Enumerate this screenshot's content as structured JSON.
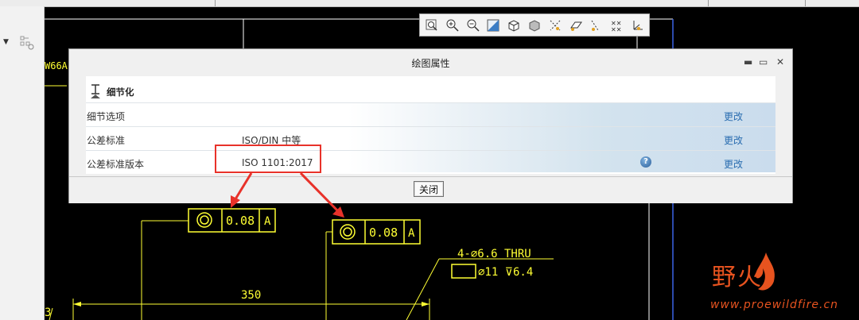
{
  "colors": {
    "accent_link": "#2a6db0",
    "highlight": "#e8322a",
    "drawing_line": "#ffff33",
    "watermark": "#e7531f"
  },
  "toolbar": {
    "icons": [
      "zoom-fit-icon",
      "zoom-in-icon",
      "zoom-out-icon",
      "repaint-icon",
      "view-manager-icon",
      "display-style-icon",
      "datum-display-icon",
      "plane-display-icon",
      "axis-display-icon",
      "point-display-icon",
      "csys-display-icon"
    ]
  },
  "dialog": {
    "title": "绘图属性",
    "controls": {
      "minimize": "▬",
      "maximize": "▭",
      "close": "✕"
    },
    "section": {
      "label": "细节化",
      "icon": "detail-icon"
    },
    "rows": [
      {
        "key": "细节选项",
        "value": "",
        "action": "更改",
        "help": false
      },
      {
        "key": "公差标准",
        "value": "ISO/DIN 中等",
        "action": "更改",
        "help": false
      },
      {
        "key": "公差标准版本",
        "value": "ISO 1101:2017",
        "action": "更改",
        "help": true
      }
    ],
    "help_glyph": "?",
    "close_button": "关闭"
  },
  "drawing": {
    "fcf1": {
      "value": "0.08",
      "datum": "A"
    },
    "fcf2": {
      "value": "0.08",
      "datum": "A"
    },
    "hole_note_1": "4-⌀6.6  THRU",
    "hole_note_2": "⌀11 ⊽6.4",
    "dimension": "350",
    "dim_left": "3",
    "partial_text": "W66A"
  },
  "watermark": {
    "brand": "野火",
    "url": "www.proewildfire.cn"
  }
}
